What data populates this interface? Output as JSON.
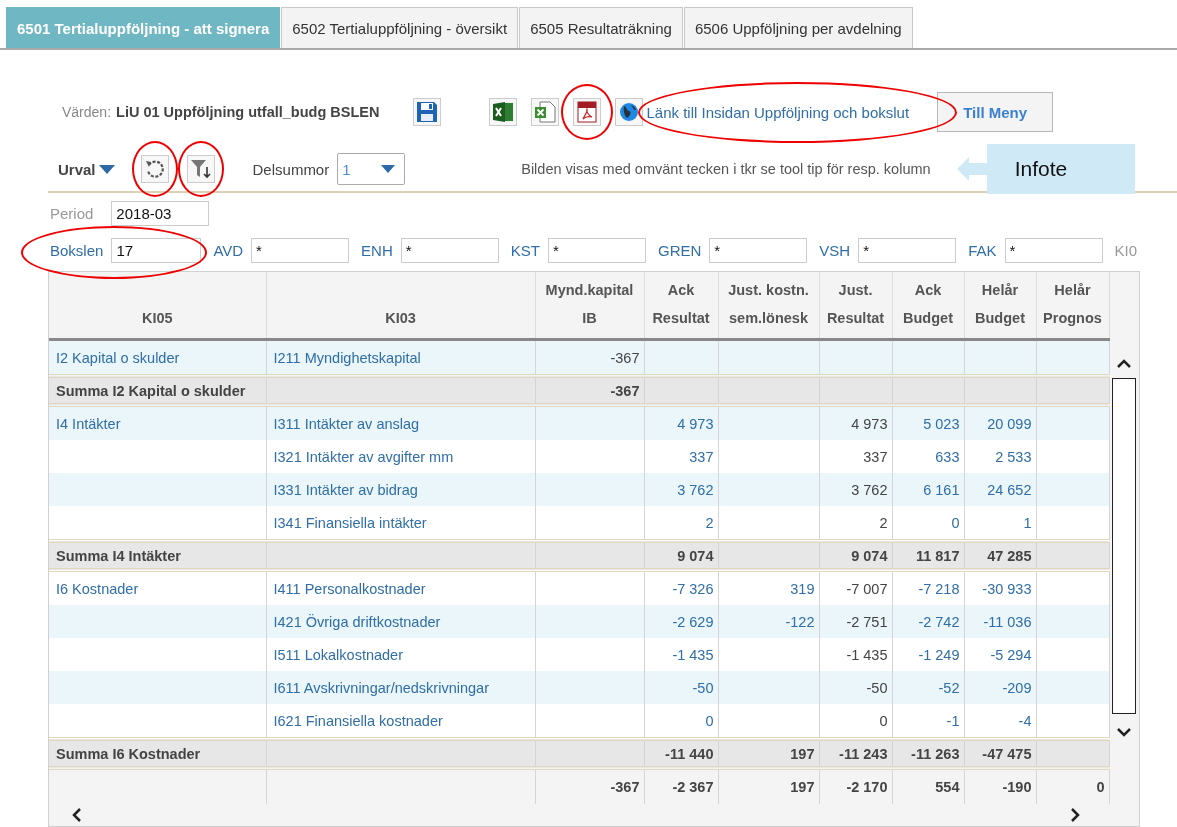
{
  "tabs": [
    {
      "label": "6501 Tertialuppföljning - att signera",
      "selected": true
    },
    {
      "label": "6502 Tertialuppföljning - översikt",
      "selected": false
    },
    {
      "label": "6505 Resultaträkning",
      "selected": false
    },
    {
      "label": "6506 Uppföljning per avdelning",
      "selected": false
    }
  ],
  "toolbar": {
    "values_label": "Värden:",
    "values_value": "LiU 01 Uppföljning utfall_budg BSLEN",
    "icons": [
      {
        "kind": "save",
        "annotated": false
      },
      {
        "kind": "excel",
        "annotated": false
      },
      {
        "kind": "excel-file",
        "annotated": false
      },
      {
        "kind": "pdf",
        "annotated": true
      },
      {
        "kind": "globe",
        "annotated": false
      }
    ],
    "link": {
      "text": "Länk till Insidan Uppföljning och bokslut",
      "annotated": true
    },
    "menu_button": "Till Meny"
  },
  "selection": {
    "label": "Urval",
    "actions": [
      {
        "kind": "refresh",
        "annotated": true
      },
      {
        "kind": "filter",
        "annotated": true
      }
    ],
    "subtotals": {
      "label": "Delsummor",
      "value": "1"
    },
    "info": "Bilden visas med omvänt tecken i tkr se tool tip för resp. kolumn",
    "callout": "Infote"
  },
  "filter_rows": [
    [
      {
        "label": "Period",
        "value": "2018-03",
        "link": false,
        "annotated": false
      }
    ],
    [
      {
        "label": "Bokslen",
        "value": "17",
        "link": true,
        "annotated": true
      },
      {
        "label": "AVD",
        "value": "*",
        "link": true,
        "annotated": false
      },
      {
        "label": "ENH",
        "value": "*",
        "link": true,
        "annotated": false
      },
      {
        "label": "KST",
        "value": "*",
        "link": true,
        "annotated": false
      },
      {
        "label": "GREN",
        "value": "*",
        "link": true,
        "annotated": false
      },
      {
        "label": "VSH",
        "value": "*",
        "link": true,
        "annotated": false
      },
      {
        "label": "FAK",
        "value": "*",
        "link": true,
        "annotated": false
      },
      {
        "label": "KI0",
        "link": false,
        "annotated": false
      }
    ]
  ],
  "table": {
    "columns": [
      {
        "lines": [
          "KI05"
        ],
        "link": true
      },
      {
        "lines": [
          "KI03"
        ],
        "link": true
      },
      {
        "lines": [
          "Mynd.kapital",
          "IB"
        ],
        "link": false
      },
      {
        "lines": [
          "Ack",
          "Resultat"
        ],
        "link": true
      },
      {
        "lines": [
          "Just. kostn.",
          "sem.lönesk"
        ],
        "link": true
      },
      {
        "lines": [
          "Just.",
          "Resultat"
        ],
        "link": false
      },
      {
        "lines": [
          "Ack",
          "Budget"
        ],
        "link": true
      },
      {
        "lines": [
          "Helår",
          "Budget"
        ],
        "link": true
      },
      {
        "lines": [
          "Helår",
          "Prognos"
        ]
      }
    ],
    "rows": [
      {
        "kind": "detail",
        "shaded": true,
        "cells": [
          "I2 Kapital o skulder",
          "I211 Myndighetskapital",
          "-367",
          null,
          null,
          null,
          null,
          null,
          null
        ]
      },
      {
        "kind": "sum",
        "cells": [
          "Summa I2 Kapital o skulder",
          null,
          "-367",
          null,
          null,
          null,
          null,
          null,
          null
        ]
      },
      {
        "kind": "detail",
        "shaded": true,
        "cells": [
          "I4 Intäkter",
          "I311 Intäkter av anslag",
          null,
          "4 973",
          null,
          "4 973",
          "5 023",
          "20 099",
          null
        ]
      },
      {
        "kind": "detail",
        "shaded": false,
        "cells": [
          null,
          "I321 Intäkter av avgifter mm",
          null,
          "337",
          null,
          "337",
          "633",
          "2 533",
          null
        ]
      },
      {
        "kind": "detail",
        "shaded": true,
        "cells": [
          null,
          "I331 Intäkter av bidrag",
          null,
          "3 762",
          null,
          "3 762",
          "6 161",
          "24 652",
          null
        ]
      },
      {
        "kind": "detail",
        "shaded": false,
        "cells": [
          null,
          "I341 Finansiella intäkter",
          null,
          "2",
          null,
          "2",
          "0",
          "1",
          null
        ]
      },
      {
        "kind": "sum",
        "cells": [
          "Summa I4 Intäkter",
          null,
          null,
          "9 074",
          null,
          "9 074",
          "11 817",
          "47 285",
          null
        ]
      },
      {
        "kind": "detail",
        "shaded": false,
        "cells": [
          "I6 Kostnader",
          "I411 Personalkostnader",
          null,
          "-7 326",
          "319",
          "-7 007",
          "-7 218",
          "-30 933",
          null
        ]
      },
      {
        "kind": "detail",
        "shaded": true,
        "cells": [
          null,
          "I421 Övriga driftkostnader",
          null,
          "-2 629",
          "-122",
          "-2 751",
          "-2 742",
          "-11 036",
          null
        ]
      },
      {
        "kind": "detail",
        "shaded": false,
        "cells": [
          null,
          "I511 Lokalkostnader",
          null,
          "-1 435",
          null,
          "-1 435",
          "-1 249",
          "-5 294",
          null
        ]
      },
      {
        "kind": "detail",
        "shaded": true,
        "cells": [
          null,
          "I611 Avskrivningar/nedskrivningar",
          null,
          "-50",
          null,
          "-50",
          "-52",
          "-209",
          null
        ]
      },
      {
        "kind": "detail",
        "shaded": false,
        "cells": [
          null,
          "I621 Finansiella kostnader",
          null,
          "0",
          null,
          "0",
          "-1",
          "-4",
          null
        ]
      },
      {
        "kind": "sum",
        "cells": [
          "Summa I6 Kostnader",
          null,
          null,
          "-11 440",
          "197",
          "-11 243",
          "-11 263",
          "-47 475",
          null
        ]
      },
      {
        "kind": "total",
        "cells": [
          null,
          null,
          "-367",
          "-2 367",
          "197",
          "-2 170",
          "554",
          "-190",
          "0"
        ]
      }
    ]
  }
}
